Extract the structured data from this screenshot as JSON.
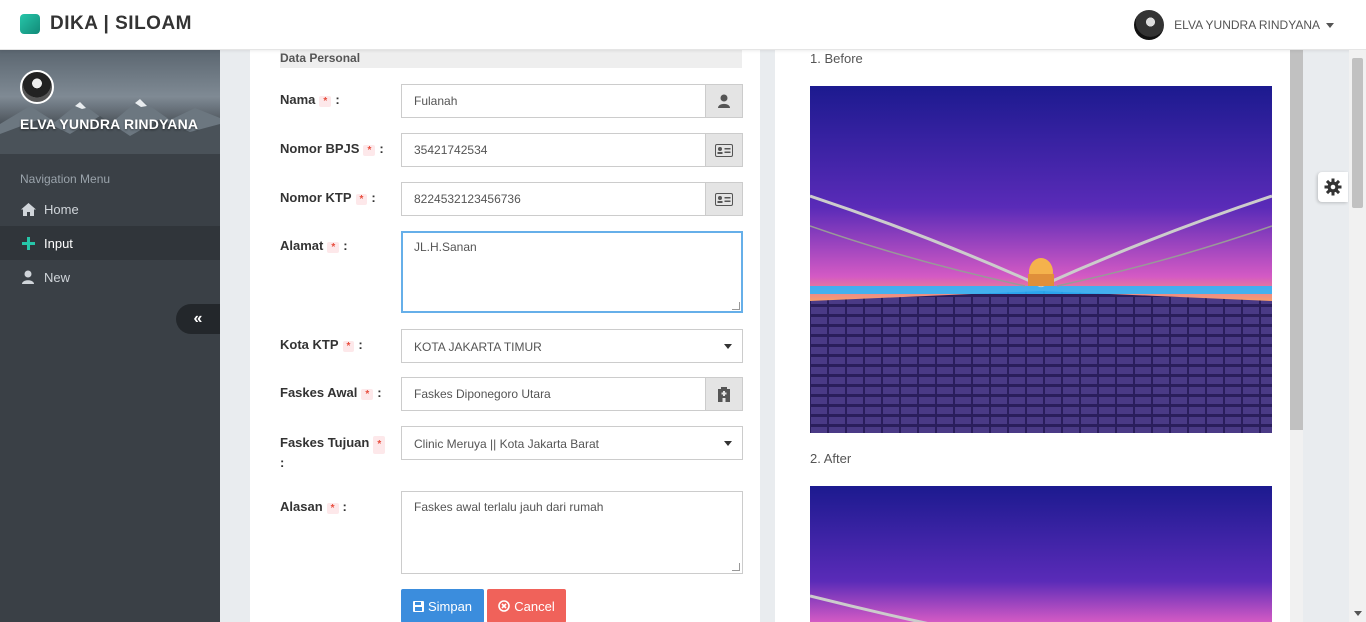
{
  "app": {
    "brand": "DIKA | SILOAM"
  },
  "user": {
    "name": "ELVA YUNDRA RINDYANA"
  },
  "sidebar": {
    "profile_name": "ELVA YUNDRA RINDYANA",
    "nav_header": "Navigation Menu",
    "items": [
      {
        "label": "Home",
        "icon": "home-icon"
      },
      {
        "label": "Input",
        "icon": "plus-icon",
        "active": true
      },
      {
        "label": "New",
        "icon": "user-icon"
      }
    ],
    "collapse_icon": "«"
  },
  "form": {
    "section_title": "Data Personal",
    "required_mark": "*",
    "colon": ":",
    "fields": {
      "nama": {
        "label": "Nama",
        "value": "Fulanah",
        "icon": "user-icon"
      },
      "bpjs": {
        "label": "Nomor BPJS",
        "value": "35421742534",
        "icon": "id-card-icon"
      },
      "ktp": {
        "label": "Nomor KTP",
        "value": "8224532123456736",
        "icon": "id-card-icon"
      },
      "alamat": {
        "label": "Alamat",
        "value": "JL.H.Sanan"
      },
      "kota": {
        "label": "Kota KTP",
        "value": "KOTA JAKARTA TIMUR"
      },
      "faskes_awal": {
        "label": "Faskes Awal",
        "value": "Faskes Diponegoro Utara",
        "icon": "hospital-icon"
      },
      "faskes_tujuan": {
        "label": "Faskes Tujuan",
        "value": "Clinic Meruya || Kota Jakarta Barat"
      },
      "alasan": {
        "label": "Alasan",
        "value": "Faskes awal terlalu jauh dari rumah"
      }
    },
    "buttons": {
      "save": "Simpan",
      "cancel": "Cancel"
    }
  },
  "preview": {
    "before_caption": "1. Before",
    "after_caption": "2. After"
  },
  "colors": {
    "accent": "#26c6a9",
    "primary": "#3b8ddd",
    "danger": "#f0625a",
    "sidebar": "#3a4046"
  }
}
